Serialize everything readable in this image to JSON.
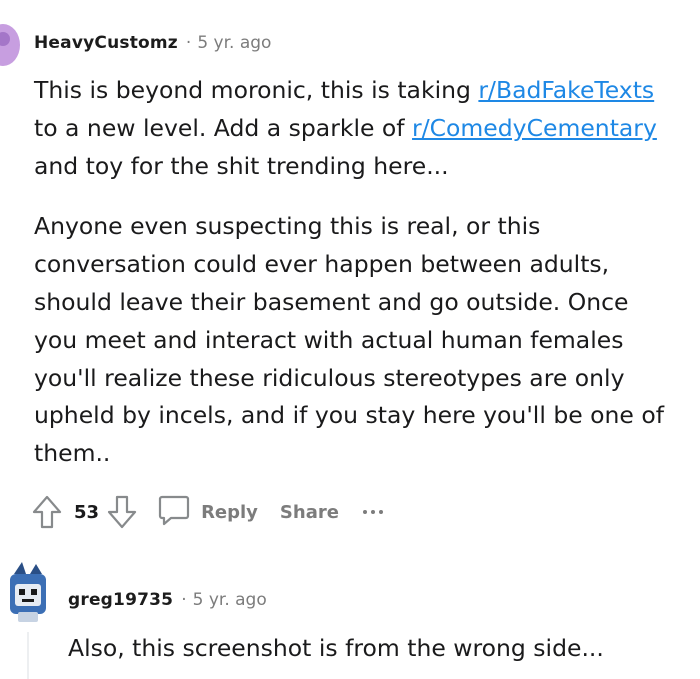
{
  "comment1": {
    "username": "HeavyCustomz",
    "separator": "·",
    "age": "5 yr. ago",
    "para1": {
      "t1": "This is beyond moronic, this is taking ",
      "link1": "r/BadFakeTexts",
      "t2": " to a new level. Add a sparkle of ",
      "link2": "r/ComedyCementary",
      "t3": " and toy for the shit trending here..."
    },
    "para2": "Anyone even suspecting this is real, or this conversation could ever happen between adults, should leave their basement and go outside. Once you meet and interact with actual human females you'll realize these ridiculous stereotypes are only upheld by incels, and if you stay here you'll be one of them..",
    "score": "53",
    "reply_label": "Reply",
    "share_label": "Share",
    "icons": [
      "upvote-icon",
      "downvote-icon",
      "comment-bubble-icon",
      "more-options-icon"
    ]
  },
  "comment2": {
    "username": "greg19735",
    "separator": "·",
    "age": "5 yr. ago",
    "body": "Also, this screenshot is from the wrong side..."
  },
  "colors": {
    "link": "#1e88e5",
    "muted": "#7c7c7c",
    "text": "#1a1a1b",
    "avatar1": "#c79ee0"
  }
}
